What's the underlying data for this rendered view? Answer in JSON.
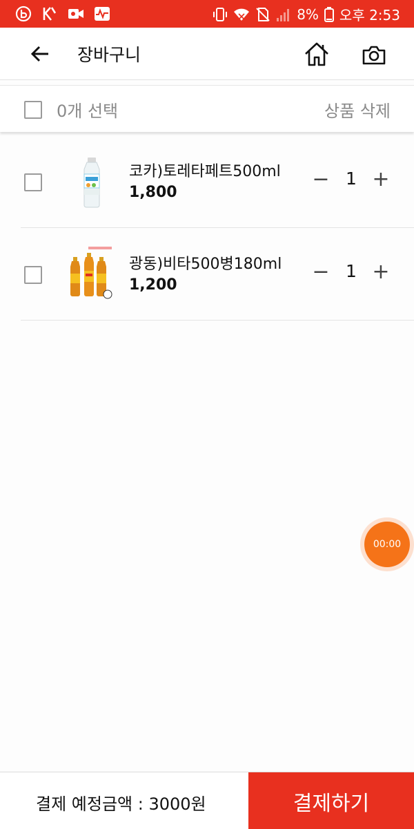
{
  "status_bar": {
    "battery": "8%",
    "time": "오후 2:53",
    "left_icons": [
      "b-app-icon",
      "k-app-icon",
      "video-icon",
      "activity-icon"
    ],
    "right_icons": [
      "vibrate-icon",
      "wifi-icon",
      "no-sim-icon",
      "signal-icon",
      "battery-icon"
    ]
  },
  "header": {
    "title": "장바구니",
    "back_icon": "arrow-left-icon",
    "home_icon": "home-icon",
    "camera_icon": "camera-icon"
  },
  "select_bar": {
    "count_label": "0개 선택",
    "delete_label": "상품 삭제"
  },
  "items": [
    {
      "name": "코카)토레타페트500ml",
      "price": "1,800",
      "quantity": "1",
      "checked": false
    },
    {
      "name": "광동)비타500병180ml",
      "price": "1,200",
      "quantity": "1",
      "checked": false
    }
  ],
  "qty_controls": {
    "minus": "−",
    "plus": "+"
  },
  "timer": {
    "label": "00:00"
  },
  "footer": {
    "total_label": "결제 예정금액 : 3000원",
    "checkout_label": "결제하기"
  },
  "colors": {
    "brand_red": "#e8301f",
    "timer_orange": "#f57318"
  }
}
